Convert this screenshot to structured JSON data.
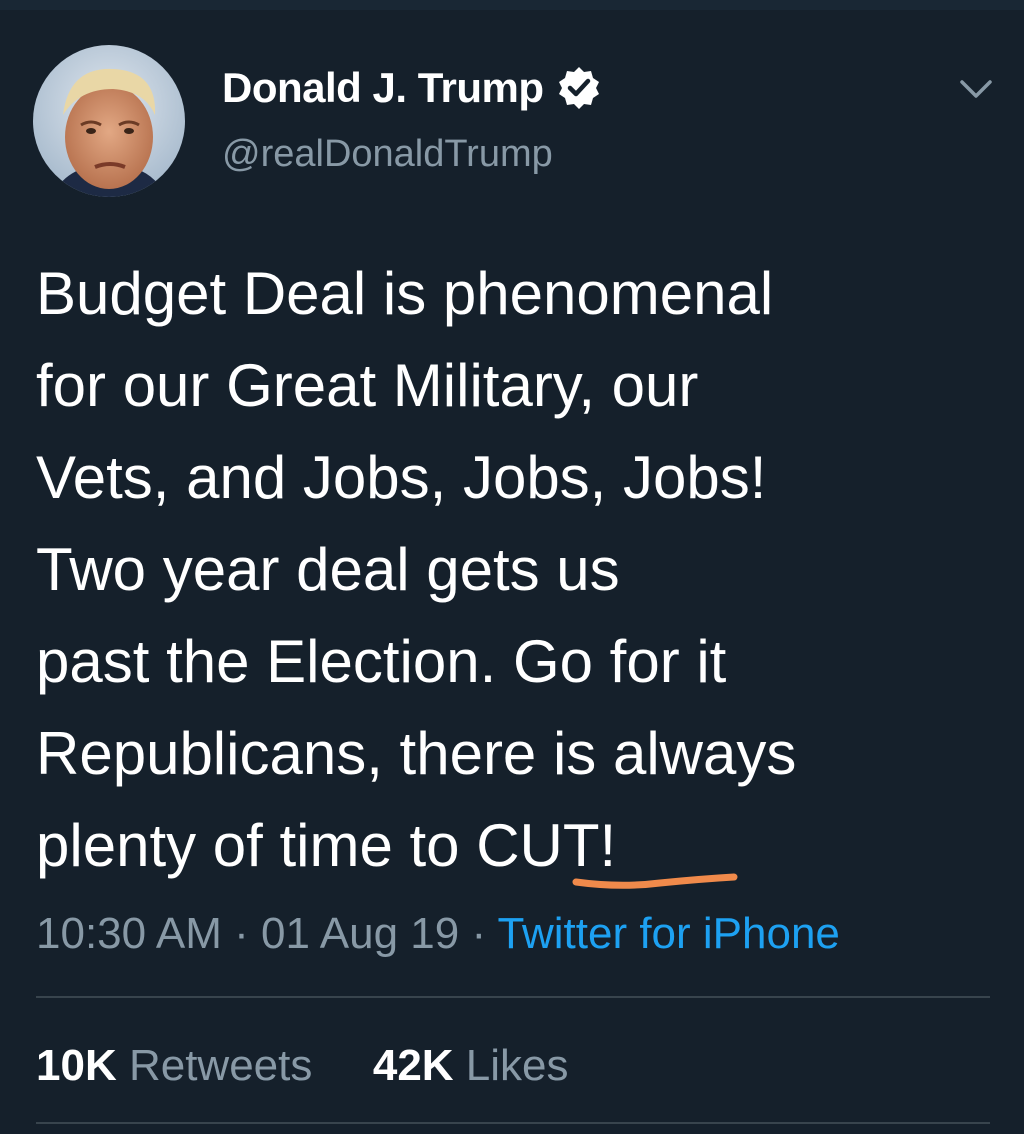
{
  "author": {
    "display_name": "Donald J. Trump",
    "handle": "@realDonaldTrump",
    "verified": true
  },
  "tweet": {
    "lines": [
      "Budget Deal is phenomenal",
      "for our Great Military, our",
      "Vets, and Jobs, Jobs, Jobs!",
      "Two year deal gets us",
      "past the Election. Go for it",
      "Republicans, there is always",
      "plenty of time to CUT!"
    ],
    "time": "10:30 AM",
    "separator": " · ",
    "date": "01 Aug 19",
    "source": "Twitter for iPhone"
  },
  "stats": {
    "retweets_count": "10K",
    "retweets_label": "Retweets",
    "likes_count": "42K",
    "likes_label": "Likes"
  },
  "colors": {
    "background": "#15202b",
    "text": "#ffffff",
    "secondary_text": "#8899a6",
    "link": "#1da1f2",
    "divider": "#38444d",
    "annotation_underline": "#f08a4b"
  },
  "icons": {
    "verified": "verified-badge-icon",
    "menu": "chevron-down-icon"
  }
}
